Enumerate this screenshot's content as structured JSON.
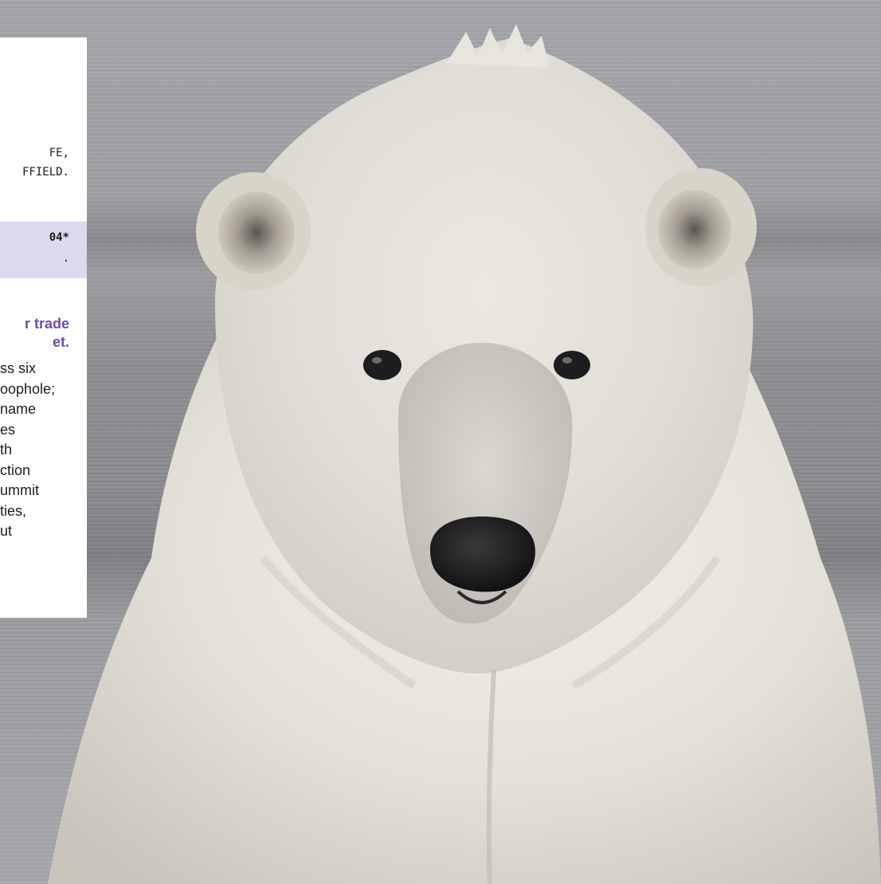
{
  "card": {
    "credit_line_1": "FE,",
    "credit_line_2": "FFIELD.",
    "tag_line_1": "04*",
    "tag_line_2": ".",
    "headline_line_1": "r trade",
    "headline_line_2": "et.",
    "body_lines": [
      "ss six",
      "oophole;",
      "name",
      "es",
      "th",
      "ction",
      "ummit",
      "ties,",
      "ut"
    ]
  },
  "photo": {
    "subject": "polar-bear-icon"
  },
  "colors": {
    "accent": "#6b4fa6",
    "tag_background": "#dcd8ee",
    "card_background": "#ffffff"
  }
}
